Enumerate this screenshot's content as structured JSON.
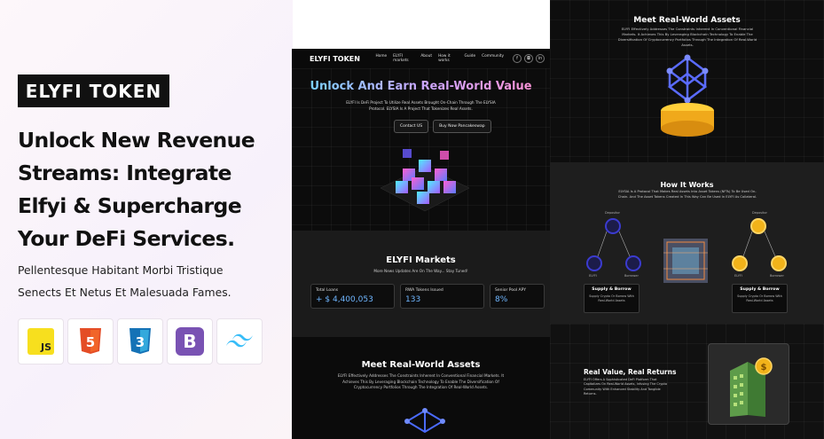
{
  "promo": {
    "badge": "ELYFI TOKEN",
    "headline_lines": [
      "Unlock New Revenue",
      "Streams: Integrate",
      "Elfyi & Supercharge",
      "Your DeFi Services."
    ],
    "subline_lines": [
      "Pellentesque Habitant Morbi Tristique",
      "Senects Et Netus Et Malesuada Fames."
    ],
    "tech": [
      {
        "name": "JS",
        "icon": "javascript-icon",
        "color": "#f7df1e"
      },
      {
        "name": "5",
        "icon": "html5-icon",
        "color": "#e44d26"
      },
      {
        "name": "3",
        "icon": "css3-icon",
        "color": "#2965f1"
      },
      {
        "name": "B",
        "icon": "bootstrap-icon",
        "color": "#7952b3"
      },
      {
        "name": "",
        "icon": "tailwind-icon",
        "color": "#38bdf8"
      }
    ]
  },
  "nav": {
    "logo": "ELYFI TOKEN",
    "links": [
      "Home",
      "ELYFI markets",
      "About",
      "How it works",
      "Guide",
      "Community"
    ],
    "social": [
      "f",
      "◘",
      "in"
    ]
  },
  "hero": {
    "title": "Unlock And Earn Real-World Value",
    "text": "ELYFI Is DeFi Project To Utilize Real Assets Brought On-Chain Through The ELYSIA Protocol. ELYSIA Is A Project That Tokenizes Real Assets.",
    "btn_contact": "Contact US",
    "btn_buy": "Buy Now Pancakeswap"
  },
  "markets": {
    "title": "ELYFI Markets",
    "subtitle": "More News Updates Are On The Way... Stay Tuned!",
    "stats": [
      {
        "label": "Total Loans",
        "value": "+ $ 4,400,053"
      },
      {
        "label": "RWA Tokens Issued",
        "value": "133"
      },
      {
        "label": "Senior Pool APY",
        "value": "8%"
      }
    ]
  },
  "meet": {
    "title": "Meet Real-World Assets",
    "text_short": "ELYFI Effectively Addresses The Constraints Inherent In Conventional Financial Markets. It Achieves This By Leveraging Blockchain Technology To Enable The Diversification Of Cryptocurrency Portfolios Through The Integration Of Real-World Assets.",
    "text": "ELYFI Effectively Addresses The Constraints Inherent In Conventional Financial Markets. It Achieves This By Leveraging Blockchain Technology To Enable The Diversification Of Cryptocurrency Portfolios Through The Integration Of Real-World Assets."
  },
  "how": {
    "title": "How It Works",
    "text": "ELYSIA Is A Protocol That Makes Real Assets Into Asset Tokens (NFTs) To Be Used On-Chain. And The Asset Tokens Created In This Way Can Be Used In ELYFI As Collateral.",
    "left_nodes": [
      "Depositor",
      "ELYFI",
      "Borrower"
    ],
    "right_nodes": [
      "Depositor",
      "ELYFI",
      "Borrower"
    ],
    "cards": [
      {
        "title": "Supply & Borrow",
        "text": "Supply Crypto Or Borrow With Real-World Assets"
      },
      {
        "title": "Supply & Borrow",
        "text": "Supply Crypto Or Borrow With Real-World Assets"
      }
    ]
  },
  "value": {
    "title": "Real Value, Real Returns",
    "text": "ELYFI Offers A Sophisticated DeFi Platform That Capitalizes On Real-World Assets, Infusing The Crypto Community With Enhanced Stability And Tangible Returns."
  }
}
